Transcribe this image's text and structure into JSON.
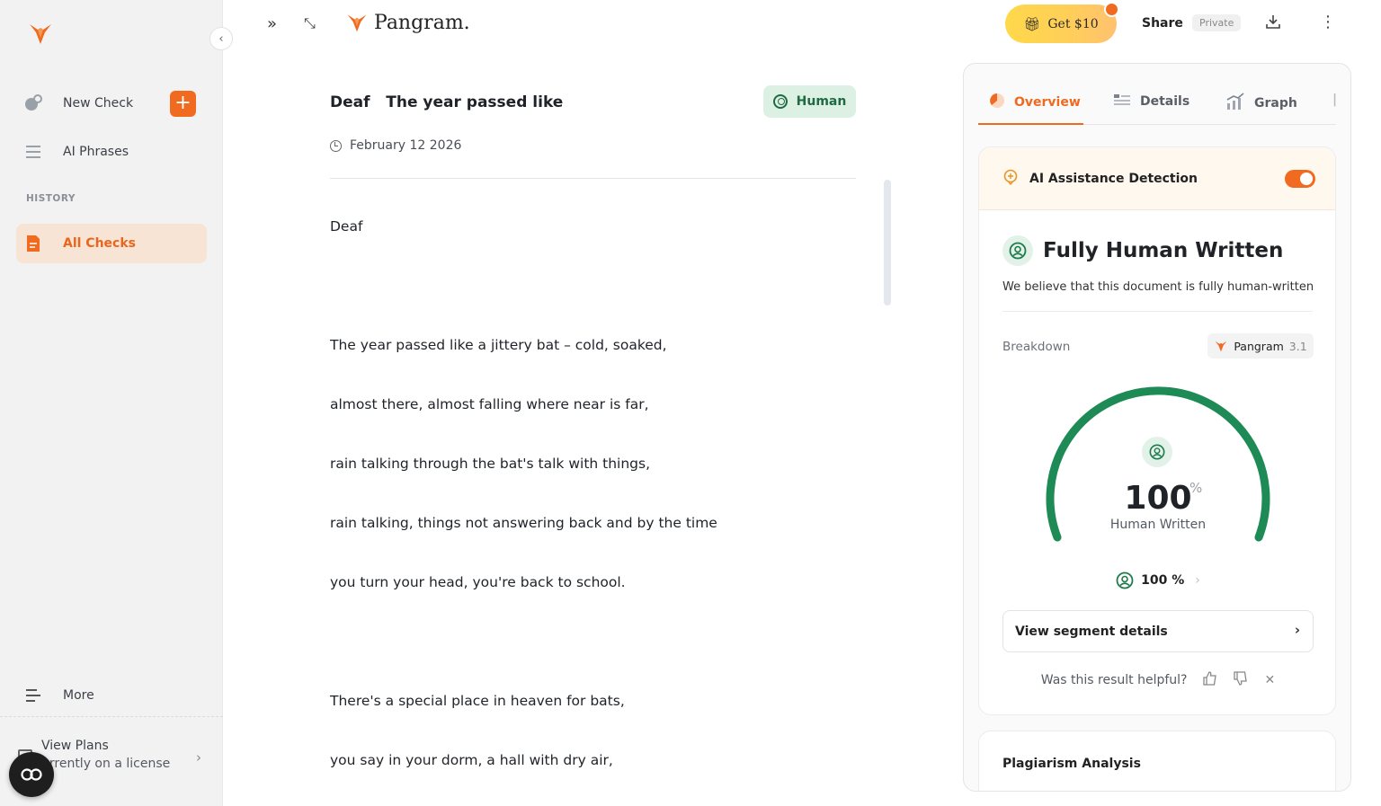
{
  "sidebar": {
    "new_check": "New Check",
    "ai_phrases": "AI Phrases",
    "history_label": "HISTORY",
    "all_checks": "All Checks",
    "more": "More",
    "plans_title": "View Plans",
    "plans_sub": "urrently on a license"
  },
  "topbar": {
    "brand": "Pangram.",
    "get_label": "Get $10",
    "share": "Share",
    "privacy": "Private"
  },
  "document": {
    "title": "Deaf   The year passed like",
    "badge": "Human",
    "date": "February 12 2026",
    "lines": [
      "Deaf",
      "The year passed like a jittery bat – cold, soaked,",
      "almost there, almost falling where near is far,",
      "rain talking through the bat's talk with things,",
      "rain talking, things not answering back and by the time",
      "you turn your head, you're back to school.",
      "There's a special place in heaven for bats,",
      "you say in your dorm, a hall with dry air,"
    ]
  },
  "panel": {
    "tabs": [
      "Overview",
      "Details",
      "Graph"
    ],
    "active_tab": "Overview",
    "detection_label": "AI Assistance Detection",
    "detection_enabled": true,
    "verdict": "Fully Human Written",
    "verdict_sub": "We believe that this document is fully human-written",
    "breakdown_label": "Breakdown",
    "model_name": "Pangram",
    "model_version": "3.1",
    "score_value": "100",
    "score_unit": "%",
    "score_label": "Human Written",
    "gauge_fraction": 1.0,
    "mini_score": "100 %",
    "segment_button": "View segment details",
    "helpful_question": "Was this result helpful?",
    "plagiarism_title": "Plagiarism Analysis"
  },
  "colors": {
    "accent": "#ee6a21",
    "human_green": "#1e8a55",
    "badge_bg": "#dcf0e4"
  }
}
